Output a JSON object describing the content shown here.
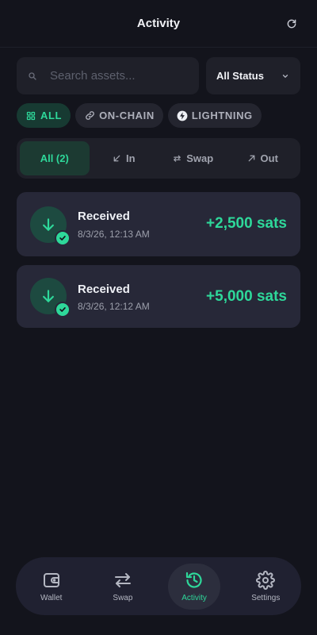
{
  "header": {
    "title": "Activity"
  },
  "search": {
    "placeholder": "Search assets..."
  },
  "status_filter": {
    "selected": "All Status"
  },
  "network_chips": [
    {
      "label": "ALL",
      "active": true,
      "icon": "grid-icon"
    },
    {
      "label": "ON-CHAIN",
      "active": false,
      "icon": "link-icon"
    },
    {
      "label": "LIGHTNING",
      "active": false,
      "icon": "lightning-icon"
    }
  ],
  "direction_tabs": [
    {
      "label": "All (2)",
      "active": true
    },
    {
      "label": "In",
      "active": false,
      "icon": "arrow-in-icon"
    },
    {
      "label": "Swap",
      "active": false,
      "icon": "swap-small-icon"
    },
    {
      "label": "Out",
      "active": false,
      "icon": "arrow-out-icon"
    }
  ],
  "transactions": [
    {
      "title": "Received",
      "date": "8/3/26, 12:13 AM",
      "amount": "+2,500 sats",
      "status": "completed"
    },
    {
      "title": "Received",
      "date": "8/3/26, 12:12 AM",
      "amount": "+5,000 sats",
      "status": "completed"
    }
  ],
  "bottom_nav": [
    {
      "label": "Wallet",
      "icon": "wallet-icon",
      "active": false
    },
    {
      "label": "Swap",
      "icon": "swap-icon",
      "active": false
    },
    {
      "label": "Activity",
      "icon": "history-icon",
      "active": true
    },
    {
      "label": "Settings",
      "icon": "gear-icon",
      "active": false
    }
  ],
  "colors": {
    "background": "#13141c",
    "surface": "#1f2029",
    "card": "#272838",
    "accent": "#2ed89a",
    "accent_bg": "#173a32",
    "muted_text": "#9c9fab"
  }
}
